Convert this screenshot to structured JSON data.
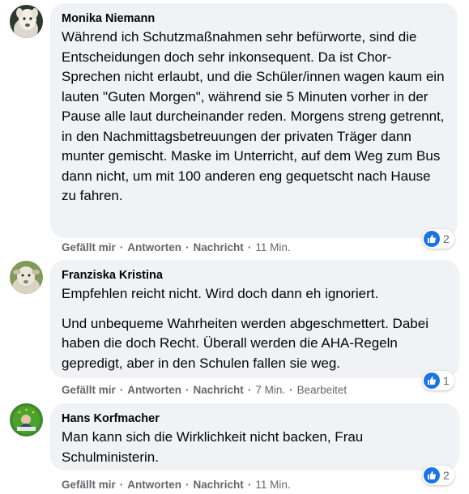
{
  "comments": [
    {
      "author": "Monika Niemann",
      "paragraphs": [
        "Während ich Schutzmaßnahmen sehr befürworte, sind die Entscheidungen doch sehr inkonsequent. Da ist Chor-Sprechen nicht erlaubt, und die Schüler/innen wagen kaum ein lauten \"Guten Morgen\", während sie 5 Minuten vorher in der Pause alle laut durcheinander reden. Morgens streng getrennt, in den Nachmittagsbetreuungen der privaten Träger dann munter gemischt. Maske im Unterricht, auf dem Weg zum Bus dann nicht, um mit 100 anderen eng gequetscht nach Hause zu fahren."
      ],
      "actions": {
        "like": "Gefällt mir",
        "reply": "Antworten",
        "message": "Nachricht"
      },
      "time": "11 Min.",
      "edited": "",
      "reaction_count": "2"
    },
    {
      "author": "Franziska Kristina",
      "paragraphs": [
        "Empfehlen reicht nicht. Wird doch dann eh ignoriert.",
        "Und unbequeme Wahrheiten werden abgeschmettert. Dabei haben die doch Recht. Überall werden die AHA-Regeln gepredigt, aber in den Schulen fallen sie weg."
      ],
      "actions": {
        "like": "Gefällt mir",
        "reply": "Antworten",
        "message": "Nachricht"
      },
      "time": "7 Min.",
      "edited": "Bearbeitet",
      "reaction_count": "1"
    },
    {
      "author": "Hans Korfmacher",
      "paragraphs": [
        "Man kann sich die Wirklichkeit nicht backen, Frau Schulministerin."
      ],
      "actions": {
        "like": "Gefällt mir",
        "reply": "Antworten",
        "message": "Nachricht"
      },
      "time": "11 Min.",
      "edited": "",
      "reaction_count": "2"
    }
  ],
  "separator": "·",
  "colors": {
    "bubble": "#f0f2f5",
    "meta": "#65676b",
    "like_blue": "#1b74e4"
  },
  "icons": {
    "reaction": "thumbs-up-icon"
  }
}
